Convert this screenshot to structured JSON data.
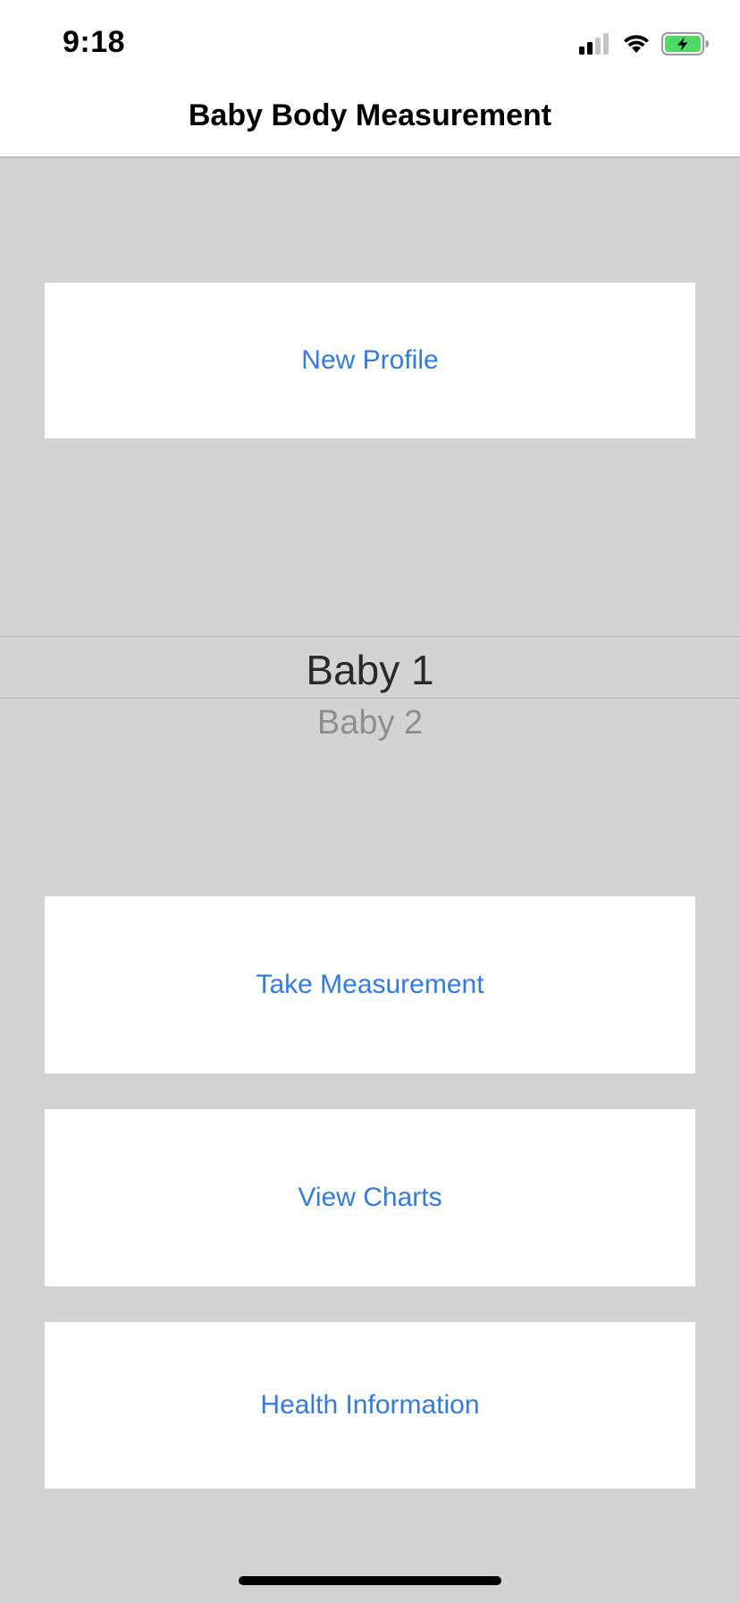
{
  "status_bar": {
    "time": "9:18",
    "icons": [
      "cellular-signal-icon",
      "wifi-icon",
      "battery-charging-icon"
    ],
    "battery_color": "#4cd964"
  },
  "nav": {
    "title": "Baby Body Measurement"
  },
  "buttons": {
    "new_profile": "New Profile",
    "take_measurement": "Take Measurement",
    "view_charts": "View Charts",
    "health_information": "Health Information"
  },
  "picker": {
    "options": [
      "Baby 1",
      "Baby 2"
    ],
    "selected": "Baby 1"
  },
  "colors": {
    "accent": "#2f7bec",
    "background": "#d3d3d3",
    "card": "#ffffff"
  }
}
